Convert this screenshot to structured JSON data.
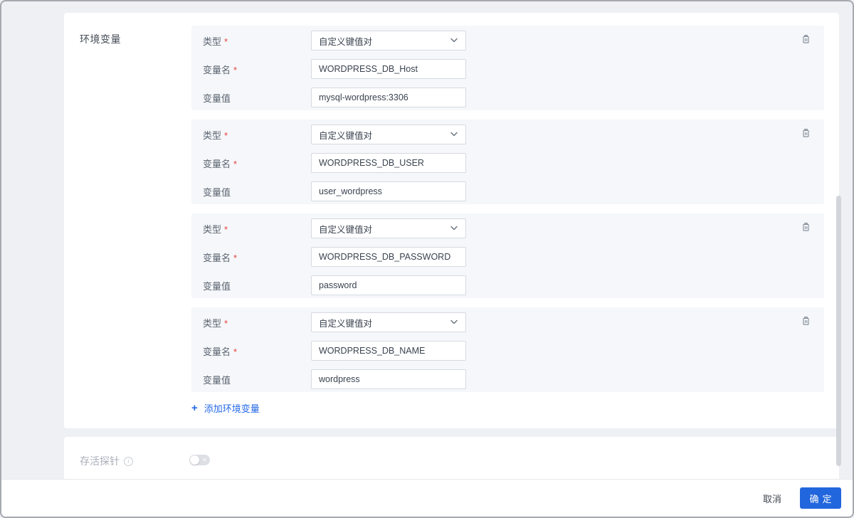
{
  "ui": {
    "required_mark": "*",
    "plus_glyph": "+"
  },
  "env_section": {
    "title": "环境变量",
    "add_button": "添加环境变量",
    "groups": [
      {
        "type_label": "类型",
        "type_value": "自定义键值对",
        "name_label": "变量名",
        "name_value": "WORDPRESS_DB_Host",
        "value_label": "变量值",
        "value_value": "mysql-wordpress:3306"
      },
      {
        "type_label": "类型",
        "type_value": "自定义键值对",
        "name_label": "变量名",
        "name_value": "WORDPRESS_DB_USER",
        "value_label": "变量值",
        "value_value": "user_wordpress"
      },
      {
        "type_label": "类型",
        "type_value": "自定义键值对",
        "name_label": "变量名",
        "name_value": "WORDPRESS_DB_PASSWORD",
        "value_label": "变量值",
        "value_value": "password"
      },
      {
        "type_label": "类型",
        "type_value": "自定义键值对",
        "name_label": "变量名",
        "name_value": "WORDPRESS_DB_NAME",
        "value_label": "变量值",
        "value_value": "wordpress"
      }
    ]
  },
  "probe_section": {
    "title": "存活探针",
    "toggle_state": "off"
  },
  "footer": {
    "cancel": "取消",
    "confirm": "确定"
  },
  "colors": {
    "accent_blue": "#2266dd",
    "link_blue": "#2468e8",
    "panel_bg": "#f5f7fa",
    "outer_bg": "#eef0f4",
    "input_border": "#d5d9e0",
    "required_red": "#e8433d"
  }
}
